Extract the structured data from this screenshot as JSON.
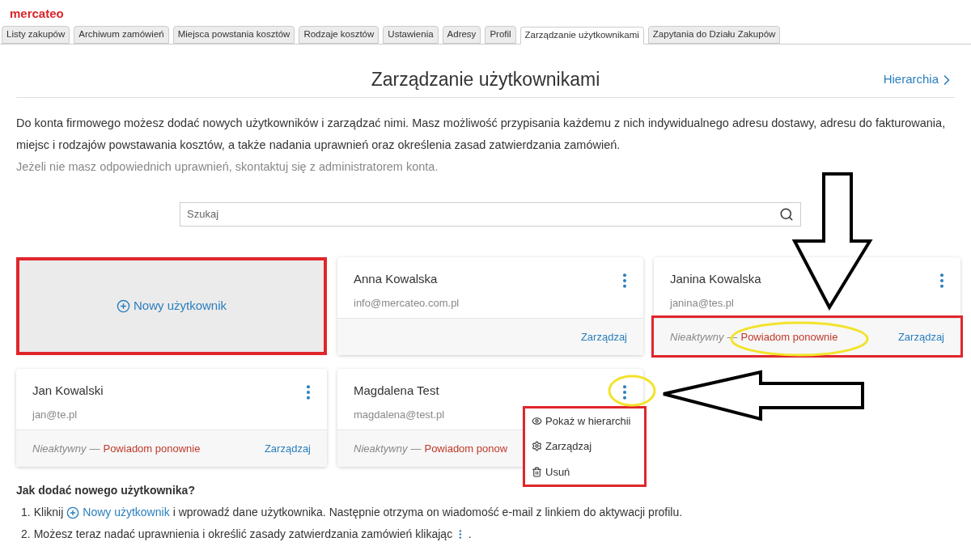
{
  "logo": "mercateo",
  "tabs": [
    {
      "label": "Listy zakupów",
      "selected": false
    },
    {
      "label": "Archiwum zamówień",
      "selected": false
    },
    {
      "label": "Miejsca powstania kosztów",
      "selected": false
    },
    {
      "label": "Rodzaje kosztów",
      "selected": false
    },
    {
      "label": "Ustawienia",
      "selected": false
    },
    {
      "label": "Adresy",
      "selected": false
    },
    {
      "label": "Profil",
      "selected": false
    },
    {
      "label": "Zarządzanie użytkownikami",
      "selected": true
    },
    {
      "label": "Zapytania do Działu Zakupów",
      "selected": false
    }
  ],
  "page_title": "Zarządzanie użytkownikami",
  "hierarchy_link": "Hierarchia",
  "intro": "Do konta firmowego możesz dodać nowych użytkowników i zarządzać nimi. Masz możliwość przypisania każdemu z nich indywidualnego adresu dostawy, adresu do fakturowania, miejsc i rodzajów powstawania kosztów, a także nadania uprawnień oraz określenia zasad zatwierdzania zamówień.",
  "note": "Jeżeli nie masz odpowiednich uprawnień, skontaktuj się z administratorem konta.",
  "search": {
    "placeholder": "Szukaj"
  },
  "new_user": "Nowy użytkownik",
  "users": [
    {
      "name": "Anna Kowalska",
      "email": "info@mercateo.com.pl",
      "manage": "Zarządzaj"
    },
    {
      "name": "Janina Kowalska",
      "email": "janina@tes.pl",
      "status": "Nieaktywny",
      "separator": "—",
      "resend": "Powiadom ponownie",
      "manage": "Zarządzaj"
    },
    {
      "name": "Jan Kowalski",
      "email": "jan@te.pl",
      "status": "Nieaktywny",
      "separator": "—",
      "resend": "Powiadom ponownie",
      "manage": "Zarządzaj"
    },
    {
      "name": "Magdalena Test",
      "email": "magdalena@test.pl",
      "status": "Nieaktywny",
      "separator": "—",
      "resend": "Powiadom ponow"
    }
  ],
  "menu": [
    {
      "kind": "view",
      "label": "Pokaż w hierarchii"
    },
    {
      "kind": "manage",
      "label": "Zarządzaj"
    },
    {
      "kind": "delete",
      "label": "Usuń"
    }
  ],
  "help": {
    "title": "Jak dodać nowego użytkownika?",
    "step1_number": "1.",
    "step1_before": "Kliknij",
    "step1_link": "Nowy użytkownik",
    "step1_after": "i wprowadź dane użytkownika. Następnie otrzyma on wiadomość e-mail z linkiem do aktywacji profilu.",
    "step2_number": "2.",
    "step2_text": "Możesz teraz nadać uprawnienia i określić zasady zatwierdzania zamówień klikając",
    "step2_end": "."
  }
}
